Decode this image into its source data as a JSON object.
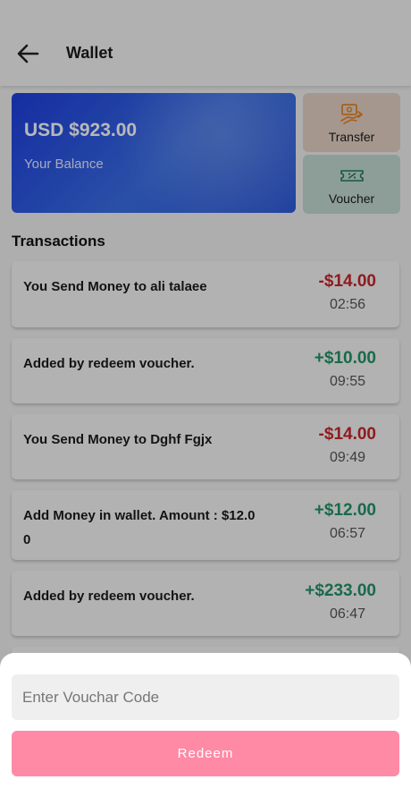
{
  "header": {
    "title": "Wallet",
    "back_icon": "arrow-left-icon"
  },
  "balance": {
    "amount": "USD $923.00",
    "caption": "Your Balance"
  },
  "actions": {
    "transfer": {
      "label": "Transfer",
      "icon": "transfer-icon",
      "bg": "#e6d2c5"
    },
    "voucher": {
      "label": "Voucher",
      "icon": "voucher-ticket-icon",
      "bg": "#c3dcd2"
    }
  },
  "transactions": {
    "title": "Transactions",
    "items": [
      {
        "description": "You Send Money to ali talaee",
        "amount": "-$14.00",
        "time": "02:56",
        "type": "debit"
      },
      {
        "description": "Added by redeem voucher.",
        "amount": "+$10.00",
        "time": "09:55",
        "type": "credit"
      },
      {
        "description": "You Send Money to Dghf Fgjx",
        "amount": "-$14.00",
        "time": "09:49",
        "type": "debit"
      },
      {
        "description": "Add Money in wallet. Amount : $12.0\n0",
        "amount": "+$12.00",
        "time": "06:57",
        "type": "credit"
      },
      {
        "description": "Added by redeem voucher.",
        "amount": "+$233.00",
        "time": "06:47",
        "type": "credit"
      }
    ]
  },
  "redeem_sheet": {
    "input_placeholder": "Enter Vouchar Code",
    "input_value": "",
    "button_label": "Redeem"
  },
  "colors": {
    "debit": "#c7262b",
    "credit": "#239469",
    "redeem_button": "#ff8aa6",
    "card_gradient_start": "#1e3fe0"
  }
}
